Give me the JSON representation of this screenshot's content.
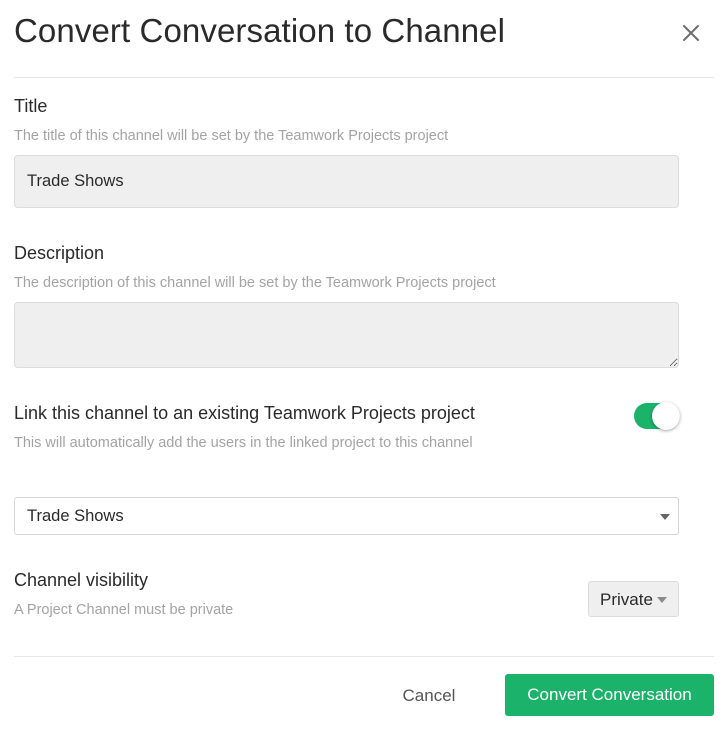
{
  "dialog": {
    "title": "Convert Conversation to Channel",
    "close_icon": "close-icon"
  },
  "title_field": {
    "label": "Title",
    "help": "The title of this channel will be set by the Teamwork Projects project",
    "value": "Trade Shows"
  },
  "description_field": {
    "label": "Description",
    "help": "The description of this channel will be set by the Teamwork Projects project",
    "value": ""
  },
  "link_project": {
    "label": "Link this channel to an existing Teamwork Projects project",
    "help": "This will automatically add the users in the linked project to this channel",
    "enabled": true,
    "selected_project": "Trade Shows"
  },
  "visibility": {
    "label": "Channel visibility",
    "help": "A Project Channel must be private",
    "selected": "Private"
  },
  "footer": {
    "cancel_label": "Cancel",
    "convert_label": "Convert Conversation"
  },
  "colors": {
    "accent": "#1bb36a",
    "input_background": "#efefef",
    "help_text": "#a3a3a3"
  }
}
